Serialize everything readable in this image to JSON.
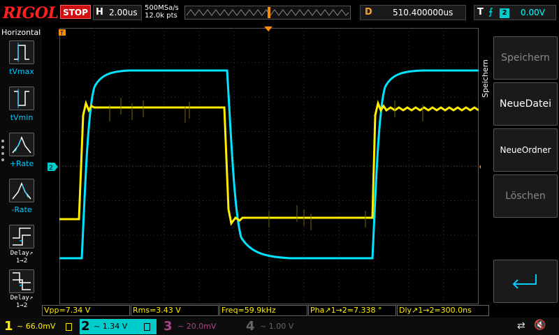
{
  "topbar": {
    "logo": "RIGOL",
    "run_state": "STOP",
    "h_label": "H",
    "timebase": "2.00us",
    "sample_rate": "500MSa/s",
    "points": "12.0k pts",
    "d_label": "D",
    "delay": "510.400000us",
    "t_label": "T",
    "trigger_edge_icon": "rising-edge-icon",
    "trigger_source": "2",
    "trigger_level": "0.00V"
  },
  "left_panel": {
    "title": "Horizontal",
    "items": [
      {
        "label": "tVmax",
        "icon": "tvmax-icon"
      },
      {
        "label": "tVmin",
        "icon": "tvmin-icon"
      },
      {
        "label": "+Rate",
        "icon": "plus-rate-icon"
      },
      {
        "label": "-Rate",
        "icon": "minus-rate-icon"
      },
      {
        "label": "Delay↗",
        "sub": "1→2",
        "icon": "delay-rise-icon"
      },
      {
        "label": "Delay↗",
        "sub": "1→2",
        "icon": "delay-fall-icon"
      }
    ]
  },
  "right_panel": {
    "title": "Speichern",
    "buttons": [
      {
        "label": "Speichern",
        "state": "dim"
      },
      {
        "label": "NeueDatei",
        "state": "active"
      },
      {
        "label": "NeueOrdner",
        "state": "active"
      },
      {
        "label": "Löschen",
        "state": "dim"
      },
      {
        "label": "",
        "icon": "enter-return-icon",
        "state": "active"
      }
    ]
  },
  "markers": {
    "ch1_ref": "1",
    "ch2_ref": "2",
    "trigger_marker": "T"
  },
  "measurements": [
    {
      "text": "Vpp=7.34 V"
    },
    {
      "text": "Rms=3.43 V"
    },
    {
      "text": "Freq=59.9kHz"
    },
    {
      "text": "Pha↗1→2=7.338 °"
    },
    {
      "text": "Dly↗1→2=300.0ns"
    }
  ],
  "channels": [
    {
      "num": "1",
      "coupling": "~",
      "scale": "66.0mV"
    },
    {
      "num": "2",
      "coupling": "~",
      "scale": "1.34 V"
    },
    {
      "num": "3",
      "coupling": "~",
      "scale": "20.0mV"
    },
    {
      "num": "4",
      "coupling": "~",
      "scale": "1.00 V"
    }
  ],
  "colors": {
    "ch1": "#ffee00",
    "ch2": "#00e5ff",
    "stop": "#d01010",
    "logo": "#ff2020",
    "delay_marker": "#ff8c00"
  }
}
